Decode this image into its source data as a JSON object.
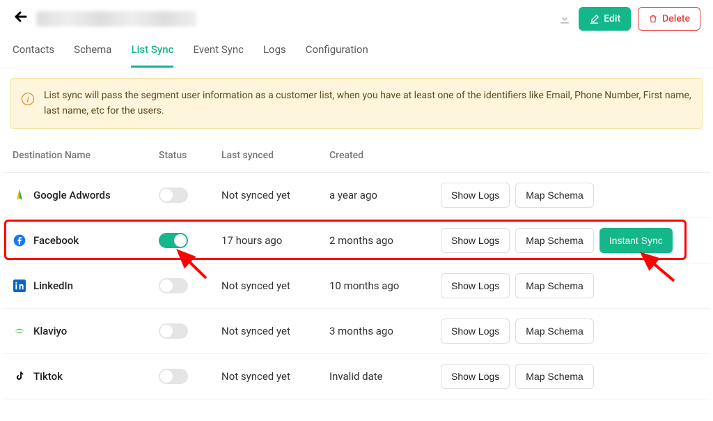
{
  "header": {
    "edit_label": "Edit",
    "delete_label": "Delete"
  },
  "tabs": [
    {
      "label": "Contacts"
    },
    {
      "label": "Schema"
    },
    {
      "label": "List Sync",
      "active": true
    },
    {
      "label": "Event Sync"
    },
    {
      "label": "Logs"
    },
    {
      "label": "Configuration"
    }
  ],
  "banner": {
    "text": "List sync will pass the segment user information as a customer list, when you have at least one of the identifiers like Email, Phone Number, First name, last name, etc for the users."
  },
  "columns": {
    "destination": "Destination Name",
    "status": "Status",
    "last_synced": "Last synced",
    "created": "Created"
  },
  "rows": [
    {
      "name": "Google Adwords",
      "icon": "google-adwords",
      "status_on": false,
      "last_synced": "Not synced yet",
      "created": "a year ago",
      "show_logs": "Show Logs",
      "map_schema": "Map Schema"
    },
    {
      "name": "Facebook",
      "icon": "facebook",
      "status_on": true,
      "last_synced": "17 hours ago",
      "created": "2 months ago",
      "show_logs": "Show Logs",
      "map_schema": "Map Schema",
      "instant_sync": "Instant Sync"
    },
    {
      "name": "LinkedIn",
      "icon": "linkedin",
      "status_on": false,
      "last_synced": "Not synced yet",
      "created": "10 months ago",
      "show_logs": "Show Logs",
      "map_schema": "Map Schema"
    },
    {
      "name": "Klaviyo",
      "icon": "klaviyo",
      "status_on": false,
      "last_synced": "Not synced yet",
      "created": "3 months ago",
      "show_logs": "Show Logs",
      "map_schema": "Map Schema"
    },
    {
      "name": "Tiktok",
      "icon": "tiktok",
      "status_on": false,
      "last_synced": "Not synced yet",
      "created": "Invalid date",
      "show_logs": "Show Logs",
      "map_schema": "Map Schema"
    }
  ]
}
